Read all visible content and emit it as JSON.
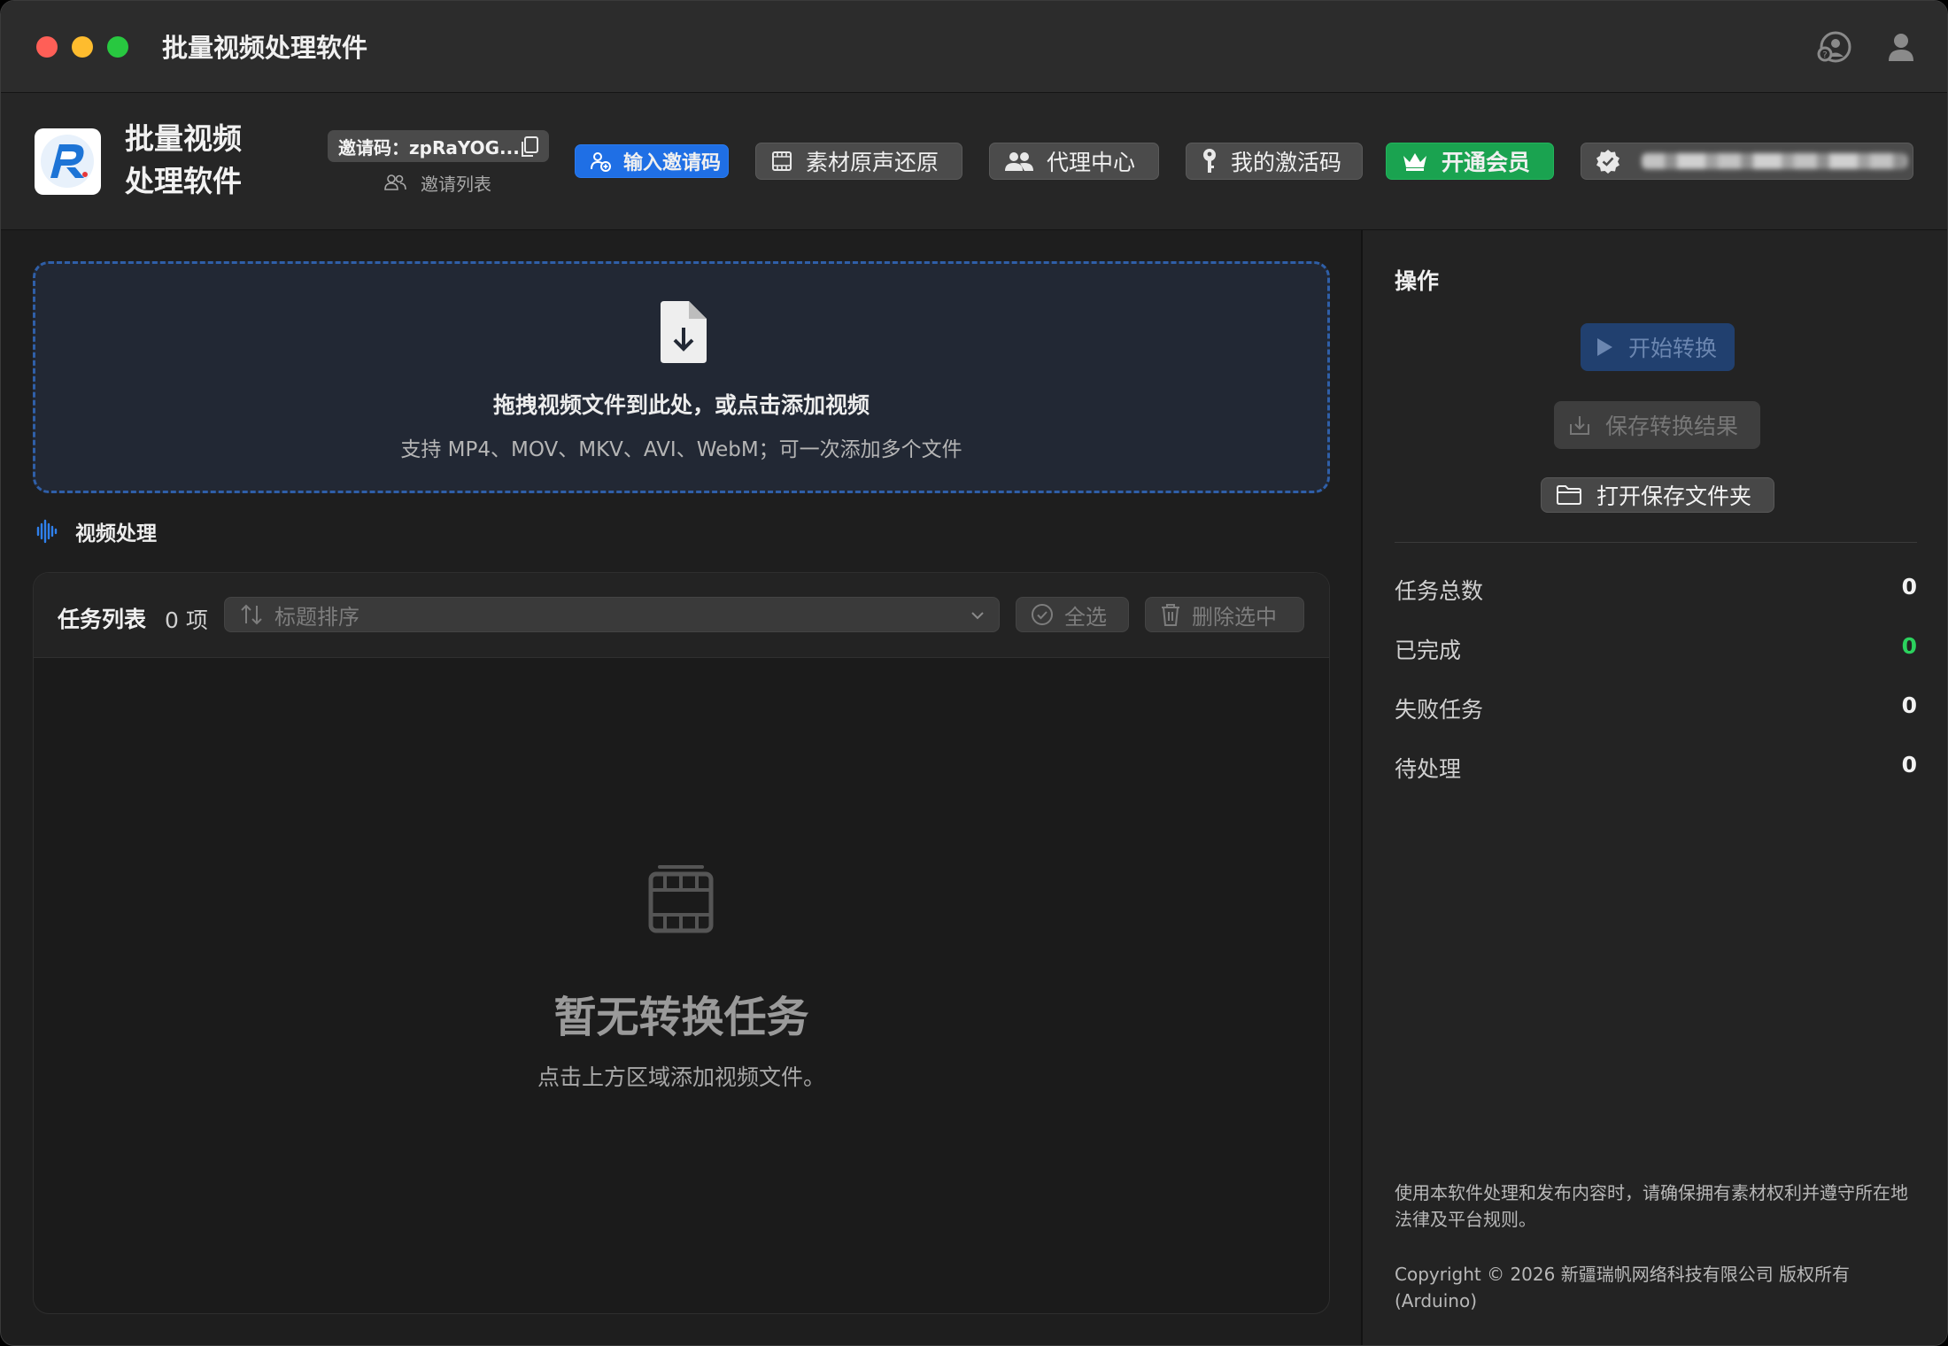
{
  "window": {
    "title": "批量视频处理软件"
  },
  "header": {
    "app_name": "批量视频处理软件",
    "invite_code_label": "邀请码：zpRaYOG...",
    "invite_list": "邀请列表",
    "buttons": {
      "enter_invite": "输入邀请码",
      "restore_audio": "素材原声还原",
      "agent_center": "代理中心",
      "activation_code": "我的激活码",
      "membership": "开通会员"
    }
  },
  "dropzone": {
    "title": "拖拽视频文件到此处，或点击添加视频",
    "subtitle": "支持 MP4、MOV、MKV、AVI、WebM；可一次添加多个文件"
  },
  "section": {
    "label": "视频处理"
  },
  "tasks": {
    "title": "任务列表",
    "count": "0 项",
    "sort_placeholder": "标题排序",
    "select_all": "全选",
    "delete_selected": "删除选中",
    "empty_title": "暂无转换任务",
    "empty_subtitle": "点击上方区域添加视频文件。"
  },
  "sidebar": {
    "title": "操作",
    "start": "开始转换",
    "save_results": "保存转换结果",
    "open_folder": "打开保存文件夹",
    "stats": [
      {
        "label": "任务总数",
        "value": "0"
      },
      {
        "label": "已完成",
        "value": "0"
      },
      {
        "label": "失败任务",
        "value": "0"
      },
      {
        "label": "待处理",
        "value": "0"
      }
    ],
    "notice": "使用本软件处理和发布内容时，请确保拥有素材权利并遵守所在地法律及平台规则。",
    "copyright": "Copyright © 2026 新疆瑞帆网络科技有限公司 版权所有 (Arduino)"
  },
  "colors": {
    "accent": "#1f6fe5",
    "success": "#1aa350",
    "completed": "#2bd15d"
  }
}
